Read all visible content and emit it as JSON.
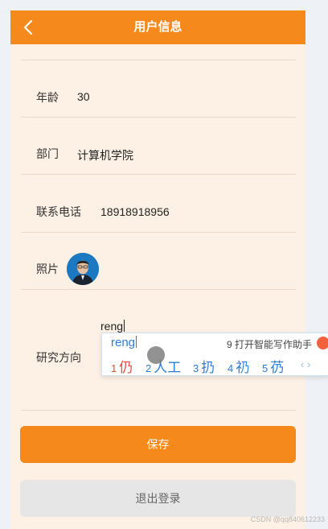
{
  "header": {
    "title": "用户信息"
  },
  "form": {
    "age": {
      "label": "年龄",
      "value": "30"
    },
    "department": {
      "label": "部门",
      "value": "计算机学院"
    },
    "phone": {
      "label": "联系电话",
      "value": "18918918956"
    },
    "photo": {
      "label": "照片"
    },
    "research": {
      "label": "研究方向",
      "value": "reng"
    }
  },
  "ime": {
    "input": "reng",
    "tip": "9 打开智能写作助手",
    "candidates": [
      {
        "num": "1",
        "text": "仍"
      },
      {
        "num": "2",
        "text": "人工"
      },
      {
        "num": "3",
        "text": "扔"
      },
      {
        "num": "4",
        "text": "礽"
      },
      {
        "num": "5",
        "text": "芿"
      }
    ],
    "pager": "‹ ›"
  },
  "buttons": {
    "save": "保存",
    "logout": "退出登录"
  },
  "watermark": "CSDN @qq840612233",
  "colors": {
    "accent": "#f5891b",
    "background": "#fdf1e6",
    "ime_blue": "#2d7cd6"
  }
}
